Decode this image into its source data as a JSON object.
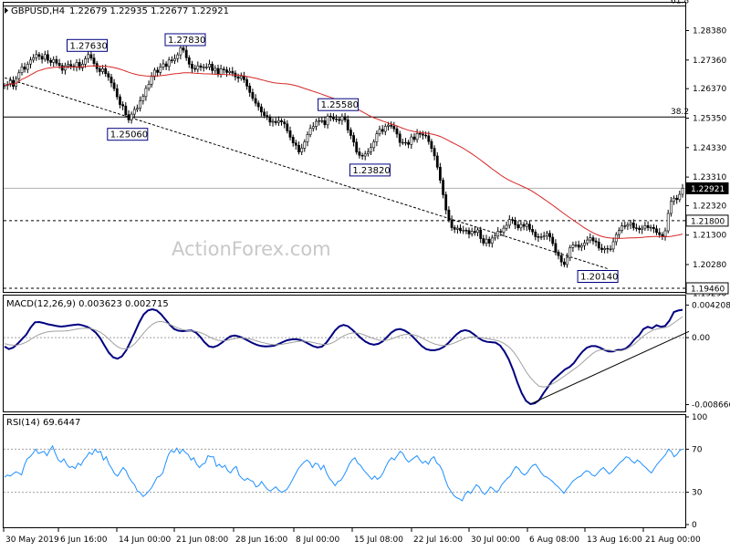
{
  "header": {
    "symbol": "GBPUSD,H4",
    "quote": "1.22679 1.22935 1.22677 1.22921"
  },
  "watermark": "ActionForex.com",
  "colors": {
    "background": "#ffffff",
    "candle": "#000000",
    "moving_average": "#d62728",
    "macd_line": "#000080",
    "signal_line": "#a0a0a0",
    "rsi_line": "#1e90ff",
    "trendline": "#000000",
    "fib_line": "#000000",
    "label_box": "#000080"
  },
  "chart_data": [
    {
      "type": "candlestick",
      "pane": "price",
      "ylim": [
        1.1946,
        1.2925
      ],
      "y_ticks": [
        "1.28380",
        "1.27360",
        "1.26370",
        "1.25350",
        "1.24330",
        "1.23310",
        "1.22320",
        "1.21300",
        "1.20280",
        "1.19290"
      ],
      "x_ticks": [
        "30 May 2019",
        "6 Jun 16:00",
        "14 Jun 00:00",
        "21 Jun 08:00",
        "28 Jun 16:00",
        "8 Jul 00:00",
        "15 Jul 08:00",
        "22 Jul 16:00",
        "30 Jul 00:00",
        "6 Aug 08:00",
        "13 Aug 16:00",
        "21 Aug 00:00"
      ],
      "last_price_label": "1.22921",
      "horizontal_levels": [
        {
          "label": "1.21800",
          "value": 1.218,
          "style": "dashed"
        },
        {
          "label": "1.19460",
          "value": 1.1946,
          "style": "dashed"
        },
        {
          "label": "1.22921",
          "value": 1.22921,
          "style": "solid-gray"
        }
      ],
      "fib_levels": [
        {
          "label": "61.8",
          "value": 1.2923
        },
        {
          "label": "38.2",
          "value": 1.2539
        }
      ],
      "annotations": [
        "1.27630",
        "1.27830",
        "1.25060",
        "1.25580",
        "1.23820",
        "1.20140"
      ],
      "moving_average": "55-period",
      "close": [
        1.2648,
        1.2652,
        1.2665,
        1.2645,
        1.2672,
        1.2692,
        1.2712,
        1.2704,
        1.2722,
        1.2736,
        1.2744,
        1.2755,
        1.2749,
        1.2739,
        1.2755,
        1.2735,
        1.2728,
        1.2738,
        1.2725,
        1.2717,
        1.2701,
        1.2716,
        1.2721,
        1.2715,
        1.2712,
        1.2728,
        1.2709,
        1.2722,
        1.2741,
        1.2755,
        1.2743,
        1.2724,
        1.2706,
        1.2696,
        1.2706,
        1.2689,
        1.2677,
        1.2657,
        1.2637,
        1.2609,
        1.2582,
        1.2577,
        1.2547,
        1.2529,
        1.2549,
        1.2565,
        1.2569,
        1.2595,
        1.261,
        1.2638,
        1.2652,
        1.2679,
        1.2701,
        1.2693,
        1.2712,
        1.2723,
        1.2714,
        1.2736,
        1.2734,
        1.2741,
        1.2754,
        1.2778,
        1.277,
        1.2744,
        1.2722,
        1.2707,
        1.2704,
        1.2716,
        1.2711,
        1.2712,
        1.2712,
        1.2722,
        1.27,
        1.2707,
        1.2686,
        1.2705,
        1.2702,
        1.2693,
        1.2697,
        1.2691,
        1.2678,
        1.2673,
        1.268,
        1.2668,
        1.2646,
        1.2624,
        1.2603,
        1.2587,
        1.2574,
        1.2556,
        1.2544,
        1.2539,
        1.2521,
        1.2524,
        1.2519,
        1.2526,
        1.2522,
        1.2515,
        1.2491,
        1.2469,
        1.2449,
        1.2441,
        1.2418,
        1.2431,
        1.2453,
        1.2478,
        1.25,
        1.2506,
        1.2524,
        1.2526,
        1.2526,
        1.2512,
        1.2542,
        1.2539,
        1.2532,
        1.2531,
        1.2527,
        1.254,
        1.2529,
        1.2494,
        1.2475,
        1.2452,
        1.2418,
        1.2406,
        1.2404,
        1.2411,
        1.2418,
        1.2433,
        1.2453,
        1.2481,
        1.2496,
        1.2489,
        1.2507,
        1.2511,
        1.2507,
        1.2498,
        1.248,
        1.2451,
        1.2451,
        1.2451,
        1.2444,
        1.247,
        1.2461,
        1.2482,
        1.248,
        1.2476,
        1.2474,
        1.2454,
        1.243,
        1.2404,
        1.2365,
        1.232,
        1.227,
        1.2217,
        1.2183,
        1.2156,
        1.215,
        1.2154,
        1.2145,
        1.2147,
        1.2146,
        1.2134,
        1.2143,
        1.2139,
        1.2148,
        1.2118,
        1.2102,
        1.2116,
        1.2102,
        1.212,
        1.2127,
        1.2143,
        1.214,
        1.2154,
        1.2164,
        1.2184,
        1.2182,
        1.2166,
        1.2155,
        1.2167,
        1.216,
        1.2168,
        1.215,
        1.2141,
        1.2125,
        1.2122,
        1.2124,
        1.2127,
        1.2136,
        1.2123,
        1.2101,
        1.2071,
        1.2059,
        1.2037,
        1.2028,
        1.2053,
        1.2087,
        1.2096,
        1.2096,
        1.2088,
        1.2094,
        1.2103,
        1.2113,
        1.2121,
        1.211,
        1.2106,
        1.2085,
        1.208,
        1.2084,
        1.2082,
        1.2082,
        1.2107,
        1.2132,
        1.2146,
        1.2162,
        1.2161,
        1.2166,
        1.2172,
        1.2155,
        1.2154,
        1.2149,
        1.2154,
        1.2163,
        1.2156,
        1.2157,
        1.2152,
        1.2139,
        1.2132,
        1.2126,
        1.2145,
        1.2205,
        1.2247,
        1.2258,
        1.2253,
        1.2271,
        1.2292
      ]
    },
    {
      "type": "line",
      "pane": "macd",
      "title": "MACD(12,26,9) 0.003623 0.002715",
      "ylim": [
        -0.0092,
        0.0052
      ],
      "y_ticks": [
        {
          "label": "0.004208",
          "value": 0.004208
        },
        {
          "label": "0.00",
          "value": 0
        },
        {
          "label": "-0.008666",
          "value": -0.008666
        }
      ],
      "series": [
        {
          "name": "MACD",
          "values": [
            -0.00116,
            -0.00149,
            -0.00129,
            -0.0008,
            -0.00019,
            0.00038,
            0.00131,
            0.00198,
            0.00201,
            0.00188,
            0.00172,
            0.00161,
            0.00149,
            0.00142,
            0.00148,
            0.00156,
            0.00165,
            0.00171,
            0.00158,
            0.00139,
            0.00109,
            0.00064,
            -6e-05,
            -0.00102,
            -0.00195,
            -0.00256,
            -0.00273,
            -0.00242,
            -0.00163,
            -0.00053,
            0.0007,
            0.00195,
            0.00298,
            0.00351,
            0.00367,
            0.00351,
            0.00302,
            0.00236,
            0.00166,
            0.00112,
            0.00089,
            0.00083,
            0.00089,
            0.00091,
            0.00067,
            0.00011,
            -0.00059,
            -0.00113,
            -0.00125,
            -0.00104,
            -0.00067,
            -0.00022,
            0.00017,
            0.00027,
            0.00012,
            -0.0001,
            -0.0004,
            -0.00069,
            -0.00092,
            -0.00109,
            -0.00114,
            -0.00112,
            -0.00105,
            -0.00084,
            -0.00058,
            -0.00035,
            -0.00024,
            -0.00021,
            -0.0003,
            -0.00051,
            -0.00082,
            -0.00112,
            -0.00127,
            -0.00117,
            -0.00069,
            8e-05,
            0.00089,
            0.00144,
            0.00164,
            0.00147,
            0.00102,
            0.00048,
            -6e-05,
            -0.00051,
            -0.0008,
            -0.00091,
            -0.00081,
            -0.00049,
            6e-05,
            0.00065,
            0.00101,
            0.00111,
            0.00093,
            0.00059,
            8e-05,
            -0.00052,
            -0.00109,
            -0.00149,
            -0.00164,
            -0.00163,
            -0.0015,
            -0.00122,
            -0.00076,
            -0.00016,
            0.00041,
            0.00082,
            0.00096,
            0.00081,
            0.00041,
            -3e-05,
            -0.00037,
            -0.00055,
            -0.00059,
            -0.00066,
            -0.00102,
            -0.00177,
            -0.0028,
            -0.0042,
            -0.0058,
            -0.0072,
            -0.0082,
            -0.0086,
            -0.0085,
            -0.0081,
            -0.0072,
            -0.0064,
            -0.0056,
            -0.0051,
            -0.0046,
            -0.0041,
            -0.0038,
            -0.0033,
            -0.0025,
            -0.0018,
            -0.0013,
            -0.0011,
            -0.0011,
            -0.0013,
            -0.0016,
            -0.0018,
            -0.0018,
            -0.0016,
            -0.0016,
            -0.0014,
            -0.0009,
            -0.0002,
            0.0003,
            0.0011,
            0.0014,
            0.0012,
            0.0016,
            0.0014,
            0.0015,
            0.0022,
            0.0033,
            0.0035,
            0.0036
          ]
        },
        {
          "name": "Signal",
          "values": [
            -0.00078,
            -0.00092,
            -0.00099,
            -0.00096,
            -0.00082,
            -0.0006,
            -0.00024,
            0.00013,
            0.00041,
            0.00061,
            0.00075,
            0.00082,
            0.00083,
            0.00083,
            0.00087,
            0.00093,
            0.00104,
            0.00114,
            0.0012,
            0.00121,
            0.00114,
            0.00098,
            0.00071,
            0.00031,
            -0.00021,
            -0.00074,
            -0.00119,
            -0.00145,
            -0.00146,
            -0.00122,
            -0.00077,
            -0.00013,
            0.00058,
            0.00122,
            0.00172,
            0.00201,
            0.00208,
            0.00196,
            0.00172,
            0.00145,
            0.00121,
            0.00103,
            0.00093,
            0.00087,
            0.00081,
            0.00067,
            0.00043,
            0.00014,
            -0.00015,
            -0.00034,
            -0.00041,
            -0.00037,
            -0.00025,
            -0.00012,
            -5e-05,
            -6e-05,
            -0.00013,
            -0.00025,
            -0.00042,
            -0.0006,
            -0.00073,
            -0.00084,
            -0.00092,
            -0.00092,
            -0.00086,
            -0.00075,
            -0.00064,
            -0.00054,
            -0.00047,
            -0.00047,
            -0.00053,
            -0.00064,
            -0.00077,
            -0.00087,
            -0.0009,
            -0.00077,
            -0.0005,
            -0.00014,
            0.00022,
            0.00046,
            0.0006,
            0.00061,
            0.00049,
            0.00029,
            7e-05,
            -0.00015,
            -0.00031,
            -0.00037,
            -0.00033,
            -0.00019,
            3e-05,
            0.00024,
            0.00038,
            0.00042,
            0.00037,
            0.00023,
            -3e-05,
            -0.00033,
            -0.00061,
            -0.00083,
            -0.00097,
            -0.00102,
            -0.00096,
            -0.0008,
            -0.00058,
            -0.00032,
            -9e-05,
            6e-05,
            9e-05,
            5e-05,
            -4e-05,
            -0.00014,
            -0.00023,
            -0.00033,
            -0.0005,
            -0.00078,
            -0.00118,
            -0.00177,
            -0.00254,
            -0.00346,
            -0.00441,
            -0.0052,
            -0.0058,
            -0.0063,
            -0.0064,
            -0.0063,
            -0.006,
            -0.0057,
            -0.0053,
            -0.0049,
            -0.0045,
            -0.0041,
            -0.0037,
            -0.0032,
            -0.0027,
            -0.0022,
            -0.0018,
            -0.0016,
            -0.0016,
            -0.0016,
            -0.0017,
            -0.0017,
            -0.0017,
            -0.0015,
            -0.0012,
            -0.0008,
            -0.0003,
            0.0002,
            0.0006,
            0.0009,
            0.0011,
            0.0012,
            0.0013,
            0.0015,
            0.0019,
            0.0023,
            0.0027
          ]
        }
      ],
      "trendline": "rising support on MACD"
    },
    {
      "type": "line",
      "pane": "rsi",
      "title": "RSI(14) 69.6447",
      "ylim": [
        0,
        100
      ],
      "y_ticks": [
        {
          "label": "100",
          "value": 100
        },
        {
          "label": "70",
          "value": 70
        },
        {
          "label": "30",
          "value": 30
        },
        {
          "label": "0",
          "value": 0
        }
      ],
      "reference_levels": [
        70,
        30
      ],
      "series": [
        {
          "name": "RSI",
          "values": [
            44,
            46,
            45,
            47,
            49,
            48,
            46,
            55,
            61,
            63,
            66,
            70,
            66,
            67,
            68,
            64,
            69,
            73,
            66,
            60,
            58,
            61,
            56,
            53,
            54,
            52,
            57,
            55,
            60,
            63,
            67,
            65,
            70,
            67,
            68,
            60,
            63,
            56,
            52,
            47,
            45,
            49,
            53,
            50,
            44,
            40,
            37,
            31,
            30,
            26,
            28,
            31,
            34,
            39,
            44,
            45,
            48,
            57,
            65,
            69,
            67,
            71,
            66,
            70,
            67,
            65,
            60,
            62,
            56,
            53,
            56,
            57,
            64,
            63,
            63,
            54,
            56,
            53,
            55,
            50,
            48,
            52,
            54,
            46,
            43,
            41,
            43,
            41,
            40,
            35,
            36,
            40,
            36,
            33,
            31,
            33,
            35,
            32,
            30,
            31,
            33,
            37,
            42,
            47,
            52,
            55,
            58,
            60,
            58,
            53,
            57,
            56,
            51,
            55,
            48,
            43,
            40,
            36,
            40,
            41,
            45,
            50,
            56,
            60,
            62,
            57,
            55,
            51,
            48,
            45,
            42,
            45,
            42,
            44,
            48,
            54,
            59,
            62,
            60,
            64,
            68,
            66,
            61,
            58,
            60,
            62,
            64,
            60,
            57,
            59,
            56,
            61,
            63,
            57,
            55,
            50,
            42,
            35,
            31,
            27,
            25,
            24,
            22,
            28,
            31,
            29,
            33,
            37,
            35,
            30,
            28,
            31,
            35,
            33,
            30,
            32,
            37,
            40,
            43,
            45,
            50,
            54,
            52,
            48,
            46,
            48,
            52,
            55,
            56,
            52,
            48,
            45,
            44,
            42,
            40,
            37,
            35,
            32,
            29,
            33,
            36,
            40,
            42,
            44,
            45,
            48,
            50,
            49,
            46,
            45,
            48,
            51,
            53,
            50,
            47,
            49,
            52,
            55,
            58,
            60,
            63,
            62,
            59,
            57,
            60,
            58,
            55,
            53,
            50,
            48,
            52,
            56,
            59,
            62,
            65,
            70,
            68,
            63,
            65,
            69,
            70
          ]
        }
      ]
    }
  ]
}
